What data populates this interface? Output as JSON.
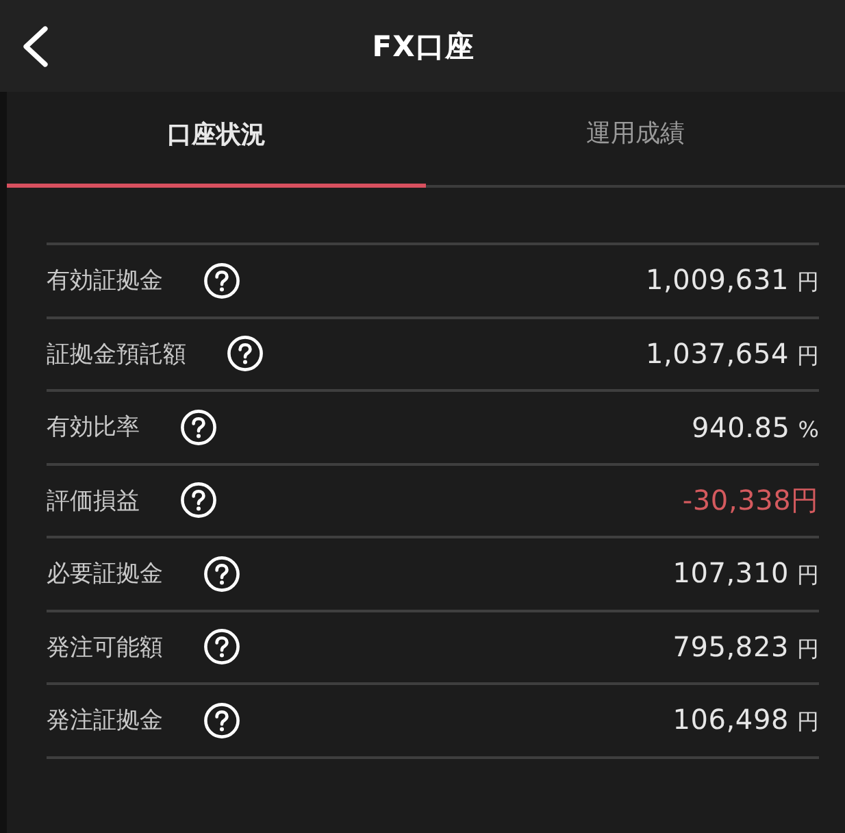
{
  "header": {
    "title": "FX口座"
  },
  "tabs": [
    {
      "label": "口座状況",
      "selected": true
    },
    {
      "label": "運用成績",
      "selected": false
    }
  ],
  "rows": [
    {
      "label": "有効証拠金",
      "value": "1,009,631",
      "unit": "円",
      "negative": false
    },
    {
      "label": "証拠金預託額",
      "value": "1,037,654",
      "unit": "円",
      "negative": false
    },
    {
      "label": "有効比率",
      "value": "940.85",
      "unit": "%",
      "negative": false
    },
    {
      "label": "評価損益",
      "value": "-30,338円",
      "negative": true
    },
    {
      "label": "必要証拠金",
      "value": "107,310",
      "unit": "円",
      "negative": false
    },
    {
      "label": "発注可能額",
      "value": "795,823",
      "unit": "円",
      "negative": false
    },
    {
      "label": "発注証拠金",
      "value": "106,498",
      "unit": "円",
      "negative": false
    }
  ]
}
